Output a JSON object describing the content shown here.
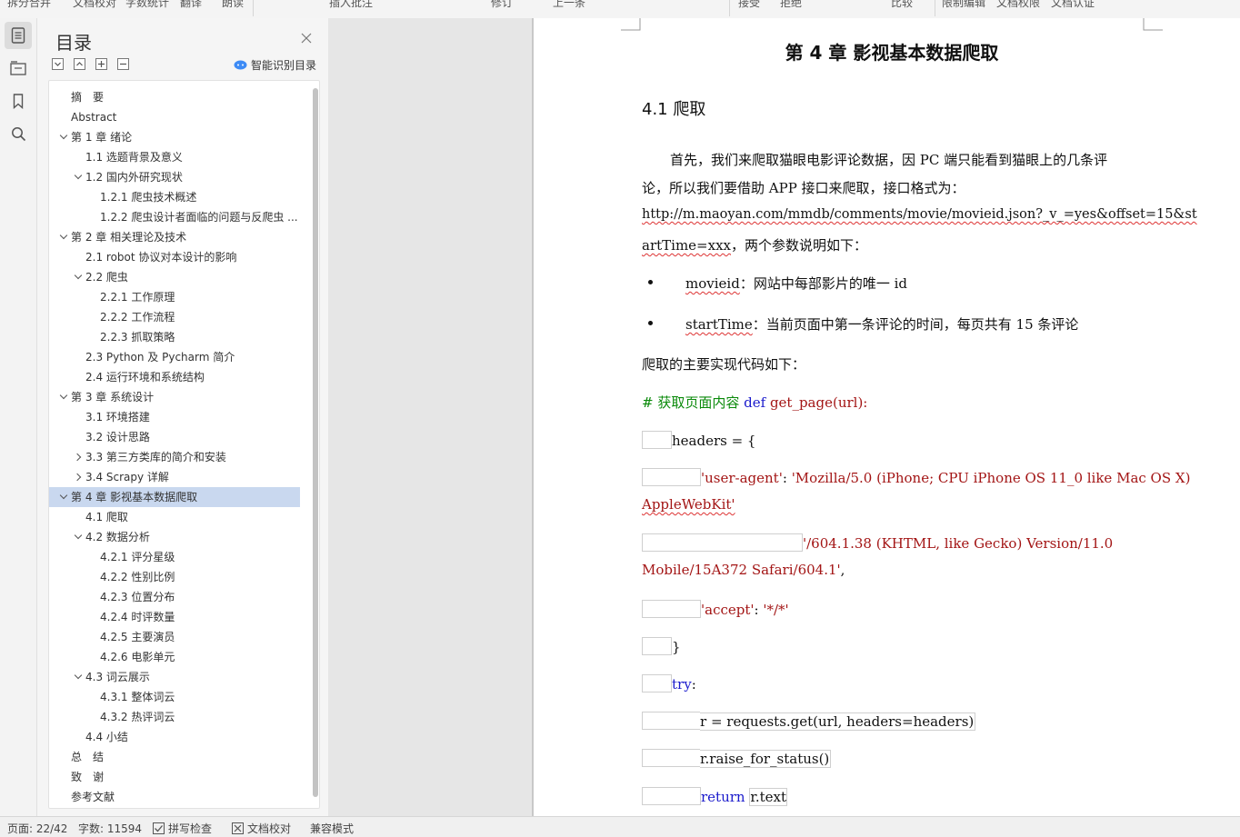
{
  "toolbar": {
    "items": [
      "拆分合并",
      "文档校对",
      "字数统计",
      "翻译",
      "朗读",
      "插入批注",
      "修订",
      "上一条",
      "下一条",
      "接受",
      "拒绝",
      "比较",
      "限制编辑",
      "文档权限",
      "文档认证"
    ]
  },
  "toc": {
    "title": "目录",
    "smart_label": "智能识别目录",
    "items": [
      {
        "label": "摘　要",
        "level": 1,
        "toggle": "none"
      },
      {
        "label": "Abstract",
        "level": 1,
        "toggle": "none"
      },
      {
        "label": "第 1 章  绪论",
        "level": 1,
        "toggle": "down"
      },
      {
        "label": "1.1  选题背景及意义",
        "level": 2,
        "toggle": "none"
      },
      {
        "label": "1.2  国内外研究现状",
        "level": 2,
        "toggle": "down"
      },
      {
        "label": "1.2.1  爬虫技术概述",
        "level": 3,
        "toggle": "none"
      },
      {
        "label": "1.2.2  爬虫设计者面临的问题与反爬虫 ...",
        "level": 3,
        "toggle": "none"
      },
      {
        "label": "第 2 章  相关理论及技术",
        "level": 1,
        "toggle": "down"
      },
      {
        "label": "2.1 robot 协议对本设计的影响",
        "level": 2,
        "toggle": "none"
      },
      {
        "label": "2.2  爬虫",
        "level": 2,
        "toggle": "down"
      },
      {
        "label": "2.2.1  工作原理",
        "level": 3,
        "toggle": "none"
      },
      {
        "label": "2.2.2  工作流程",
        "level": 3,
        "toggle": "none"
      },
      {
        "label": "2.2.3  抓取策略",
        "level": 3,
        "toggle": "none"
      },
      {
        "label": "2.3 Python 及 Pycharm 简介",
        "level": 2,
        "toggle": "none"
      },
      {
        "label": "2.4 运行环境和系统结构",
        "level": 2,
        "toggle": "none"
      },
      {
        "label": "第 3 章  系统设计",
        "level": 1,
        "toggle": "down"
      },
      {
        "label": "3.1 环境搭建",
        "level": 2,
        "toggle": "none"
      },
      {
        "label": "3.2 设计思路",
        "level": 2,
        "toggle": "none"
      },
      {
        "label": "3.3  第三方类库的简介和安装",
        "level": 2,
        "toggle": "right"
      },
      {
        "label": "3.4 Scrapy 详解",
        "level": 2,
        "toggle": "right"
      },
      {
        "label": "第 4 章  影视基本数据爬取",
        "level": 1,
        "toggle": "down",
        "selected": true
      },
      {
        "label": "4.1 爬取",
        "level": 2,
        "toggle": "none"
      },
      {
        "label": "4.2 数据分析",
        "level": 2,
        "toggle": "down"
      },
      {
        "label": "4.2.1 评分星级",
        "level": 3,
        "toggle": "none"
      },
      {
        "label": "4.2.2 性别比例",
        "level": 3,
        "toggle": "none"
      },
      {
        "label": "4.2.3 位置分布",
        "level": 3,
        "toggle": "none"
      },
      {
        "label": "4.2.4 时评数量",
        "level": 3,
        "toggle": "none"
      },
      {
        "label": "4.2.5 主要演员",
        "level": 3,
        "toggle": "none"
      },
      {
        "label": "4.2.6 电影单元",
        "level": 3,
        "toggle": "none"
      },
      {
        "label": "4.3 词云展示",
        "level": 2,
        "toggle": "down"
      },
      {
        "label": "4.3.1 整体词云",
        "level": 3,
        "toggle": "none"
      },
      {
        "label": "4.3.2 热评词云",
        "level": 3,
        "toggle": "none"
      },
      {
        "label": "4.4 小结",
        "level": 2,
        "toggle": "none"
      },
      {
        "label": "总　结",
        "level": 1,
        "toggle": "none"
      },
      {
        "label": "致　谢",
        "level": 1,
        "toggle": "none"
      },
      {
        "label": "参考文献",
        "level": 1,
        "toggle": "none"
      }
    ]
  },
  "doc": {
    "chapter_title": "第 4 章  影视基本数据爬取",
    "section_title": "4.1 爬取",
    "para1_line1": "首先，我们来爬取猫眼电影评论数据，因 PC 端只能看到猫眼上的几条评",
    "para1_line2": "论，所以我们要借助 APP 接口来爬取，接口格式为：",
    "url_line1": "http://m.maoyan.com/mmdb/comments/movie/movieid.json?_v_=yes&offset=15&st",
    "url_line2_a": "artTime=xxx",
    "url_line2_b": "，两个参数说明如下：",
    "bullet1_key": "movieid",
    "bullet1_text": "：网站中每部影片的唯一 id",
    "bullet2_key": "startTime",
    "bullet2_text": "：当前页面中第一条评论的时间，每页共有 15 条评论",
    "code_intro": "爬取的主要实现代码如下：",
    "code_comment": "# 获取页面内容",
    "code_def": "def",
    "code_fn": "get_page(url):",
    "code_headers": "headers = {",
    "code_ua_key": "'user-agent'",
    "code_colon": ":",
    "code_ua_val1": "'Mozilla/5.0 (iPhone; CPU iPhone OS 11_0 like Mac OS X)",
    "code_ua_val2": "AppleWebKit'",
    "code_ua_val3": "'/604.1.38 (KHTML, like Gecko) Version/11.0",
    "code_ua_val4": "Mobile/15A372 Safari/604.1'",
    "code_comma": ",",
    "code_accept_key": "'accept'",
    "code_accept_val": "'*/*'",
    "code_brace": "}",
    "code_try": "try",
    "code_req": "r = requests.get(url, headers=headers)",
    "code_raise": "r.raise_for_status()",
    "code_return": "return",
    "code_rtext": "r.text"
  },
  "status": {
    "page": "页面: 22/42",
    "words": "字数: 11594",
    "spell": "拼写检查",
    "proof": "文档校对",
    "compat": "兼容模式"
  },
  "colors": {
    "keyword": "#1a1acc",
    "string": "#a31515",
    "comment": "#0a8a0a",
    "selection": "#c9d8ef"
  }
}
